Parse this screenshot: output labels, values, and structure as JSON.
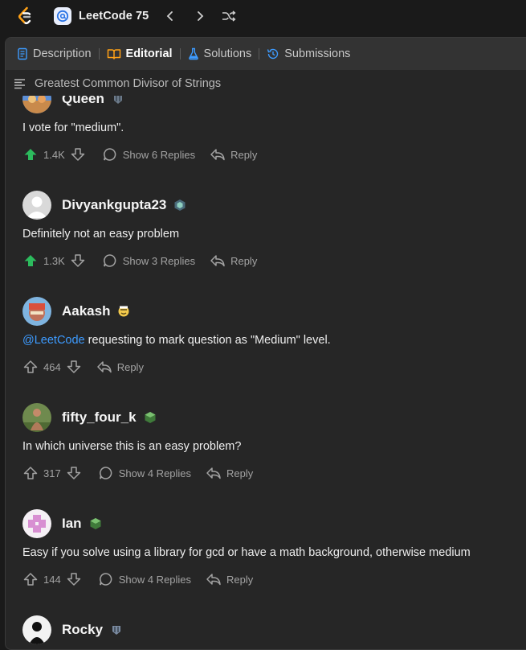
{
  "header": {
    "problem_list_title": "LeetCode 75"
  },
  "tabs": [
    {
      "label": "Description",
      "icon": "description-icon"
    },
    {
      "label": "Editorial",
      "icon": "book-icon",
      "active": true
    },
    {
      "label": "Solutions",
      "icon": "flask-icon"
    },
    {
      "label": "Submissions",
      "icon": "history-icon"
    }
  ],
  "breadcrumb_title": "Greatest Common Divisor of Strings",
  "comments": [
    {
      "username": "Queen",
      "text": "I vote for \"medium\".",
      "upvotes": "1.4K",
      "upvoted": true,
      "replies_label": "Show 6 Replies",
      "reply_label": "Reply"
    },
    {
      "username": "Divyankgupta23",
      "text": "Definitely not an easy problem",
      "upvotes": "1.3K",
      "upvoted": true,
      "replies_label": "Show 3 Replies",
      "reply_label": "Reply"
    },
    {
      "username": "Aakash",
      "mention": "@LeetCode",
      "text": " requesting to mark question as \"Medium\" level.",
      "upvotes": "464",
      "upvoted": false,
      "replies_label": "",
      "reply_label": "Reply"
    },
    {
      "username": "fifty_four_k",
      "text": "In which universe this is an easy problem?",
      "upvotes": "317",
      "upvoted": false,
      "replies_label": "Show 4 Replies",
      "reply_label": "Reply"
    },
    {
      "username": "Ian",
      "text": "Easy if you solve using a library for gcd or have a math background, otherwise medium",
      "upvotes": "144",
      "upvoted": false,
      "replies_label": "Show 4 Replies",
      "reply_label": "Reply"
    },
    {
      "username": "Rocky",
      "text": "",
      "upvotes": "",
      "upvoted": false,
      "replies_label": "",
      "reply_label": ""
    }
  ],
  "colors": {
    "upvote_active": "#2cbb5d",
    "editorial_icon": "#ffa116",
    "solutions_icon": "#3d9bff",
    "mention": "#3d9bff"
  }
}
